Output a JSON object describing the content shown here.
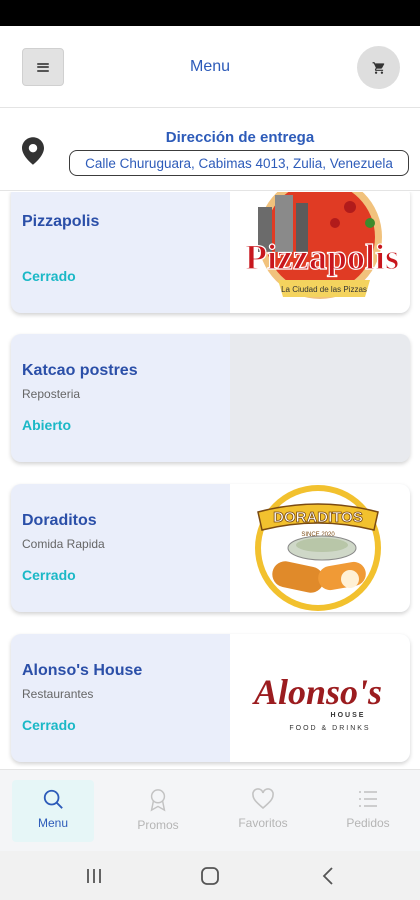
{
  "header": {
    "title": "Menu",
    "menu_icon": "hamburger-icon",
    "cart_icon": "shopping-cart-icon"
  },
  "delivery": {
    "label": "Dirección de entrega",
    "address": "Calle Churuguara, Cabimas 4013, Zulia, Venezuela",
    "icon": "location-pin-icon"
  },
  "colors": {
    "accent_blue": "#2d5bb9",
    "status_teal": "#1bb8c6",
    "card_bg": "#eaeefa"
  },
  "restaurants": [
    {
      "name": "Pizzapolis",
      "category": "",
      "status": "Cerrado",
      "logo": {
        "line1": "Pizzapolis",
        "line2": "La Ciudad de las Pizzas"
      }
    },
    {
      "name": "Katcao postres",
      "category": "Reposteria",
      "status": "Abierto",
      "logo": null
    },
    {
      "name": "Doraditos",
      "category": "Comida Rapida",
      "status": "Cerrado",
      "logo": {
        "line1": "DORADITOS",
        "line2": "SINCE 2020"
      }
    },
    {
      "name": "Alonso's House",
      "category": "Restaurantes",
      "status": "Cerrado",
      "logo": {
        "line1": "Alonso's",
        "line2": "HOUSE",
        "line3": "FOOD & DRINKS"
      }
    }
  ],
  "bottom_nav": [
    {
      "label": "Menu",
      "icon": "search-icon",
      "active": true
    },
    {
      "label": "Promos",
      "icon": "badge-icon",
      "active": false
    },
    {
      "label": "Favoritos",
      "icon": "heart-icon",
      "active": false
    },
    {
      "label": "Pedidos",
      "icon": "list-icon",
      "active": false
    }
  ],
  "system_nav": [
    "recent-apps-icon",
    "home-icon",
    "back-icon"
  ]
}
